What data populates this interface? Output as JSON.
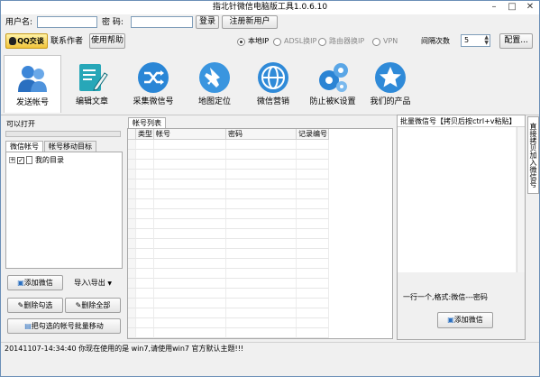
{
  "window": {
    "title": "指北针微信电脑版工具1.0.6.10"
  },
  "login": {
    "user_label": "用户名:",
    "pass_label": "密  码:",
    "user_value": "",
    "pass_value": "",
    "login_button": "登录",
    "register_button": "注册新用户"
  },
  "row2": {
    "qq_button": "QQ交谈",
    "contact_author": "联系作者",
    "help_button": "使用帮助",
    "radios": [
      {
        "label": "本地IP",
        "checked": true
      },
      {
        "label": "ADSL换IP",
        "checked": false
      },
      {
        "label": "路由器换IP",
        "checked": false
      },
      {
        "label": "VPN",
        "checked": false
      }
    ],
    "interval_label": "间隔次数",
    "interval_value": "5",
    "config_button": "配置..."
  },
  "toolbar": {
    "items": [
      {
        "label": "发送帐号",
        "icon": "people-icon",
        "active": true
      },
      {
        "label": "编辑文章",
        "icon": "edit-document-icon",
        "active": false
      },
      {
        "label": "采集微信号",
        "icon": "shuffle-icon",
        "active": false
      },
      {
        "label": "地图定位",
        "icon": "pushpin-icon",
        "active": false
      },
      {
        "label": "微信营销",
        "icon": "globe-icon",
        "active": false
      },
      {
        "label": "防止被K设置",
        "icon": "gears-icon",
        "active": false
      },
      {
        "label": "我们的产品",
        "icon": "star-icon",
        "active": false
      }
    ]
  },
  "left": {
    "can_open": "可以打开",
    "tabs": [
      "微信帐号",
      "帐号移动目标"
    ],
    "tree_root": "我的目录",
    "buttons": {
      "add": "添加微信",
      "import_export": "导入\\导出",
      "delete_checked": "删除勾选",
      "delete_all": "删除全部",
      "move_checked": "把勾选的帐号批量移动"
    }
  },
  "grid": {
    "tab": "帐号列表",
    "columns": [
      "类型",
      "帐号",
      "密码",
      "记录编号"
    ]
  },
  "right": {
    "batch_label": "批量微信号【拷贝后按ctrl+v粘贴】",
    "hint": "一行一个,格式:微信---密码",
    "add_button": "添加微信",
    "side_tab": "直接拷贝加入微信号"
  },
  "status": {
    "text": "20141107-14:34:40  你现在使用的是 win7,请使用win7 官方默认主题!!!"
  }
}
